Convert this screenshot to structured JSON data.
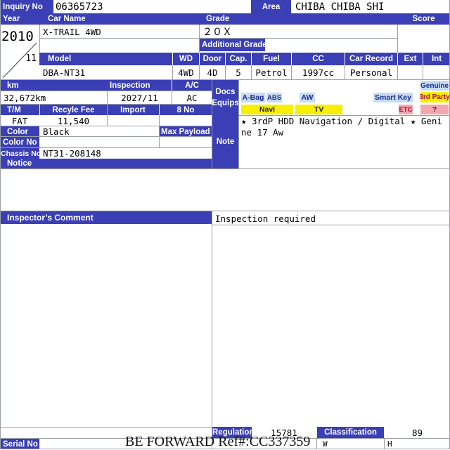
{
  "header": {
    "inquiry_label": "Inquiry No",
    "inquiry_value": "06365723",
    "area_label": "Area",
    "area_value": "CHIBA CHIBA SHI"
  },
  "vehicle": {
    "year_label": "Year",
    "year_value": "2010",
    "month_value": "11",
    "car_name_label": "Car Name",
    "car_name_value": "X-TRAIL 4WD",
    "grade_label": "Grade",
    "grade_value": "２０Ｘ",
    "additional_grade_label": "Additional Grade",
    "additional_grade_value": "",
    "score_label": "Score",
    "score_value": ""
  },
  "model_row": {
    "model_label": "Model",
    "model_value": "DBA-NT31",
    "wd_label": "WD",
    "wd_value": "4WD",
    "door_label": "Door",
    "door_value": "4D",
    "cap_label": "Cap.",
    "cap_value": "5",
    "fuel_label": "Fuel",
    "fuel_value": "Petrol",
    "cc_label": "CC",
    "cc_value": "1997cc",
    "car_record_label": "Car Record",
    "car_record_value": "Personal",
    "ext_label": "Ext",
    "ext_value": "",
    "int_label": "Int",
    "int_value": ""
  },
  "specs": {
    "km_label": "km",
    "km_value": "32,672km",
    "inspection_label": "Inspection",
    "inspection_value": "2027/11",
    "ac_label": "A/C",
    "ac_value": "AC",
    "tm_label": "T/M",
    "tm_value": "FAT",
    "recycle_label": "Recyle Fee",
    "recycle_value": "11,540",
    "import_label": "Import",
    "import_value": "",
    "eight_no_label": "8 No",
    "eight_no_value": "",
    "color_label": "Color",
    "color_value": "Black",
    "max_payload_label": "Max Payload",
    "max_payload_value": "",
    "color_no_label": "Color No",
    "color_no_value": "",
    "chassis_label": "Chassis No",
    "chassis_value": "NT31-208148",
    "notice_label": "Notice",
    "notice_value": ""
  },
  "equipment": {
    "docs_label": "Docs",
    "equips_label": "Equips",
    "abag": "A-Bag",
    "abs": "ABS",
    "aw": "AW",
    "smart_key": "Smart Key",
    "genuine": "Genuine",
    "third_party": "3rd Party",
    "navi": "Navi",
    "tv": "TV",
    "etc": "ETC",
    "question": "?",
    "note_label": "Note",
    "note_text": "★ 3rdP HDD Navigation / Digital ★ Genine 17 Aw"
  },
  "comments": {
    "inspector_label": "Inspector’s Comment",
    "inspector_value": "",
    "right_value": "Inspection required"
  },
  "footer": {
    "regulation_label": "Regulation",
    "regulation_value": "15781",
    "classification_label": "Classification",
    "classification_value": "89",
    "serial_label": "Serial No",
    "serial_value": "",
    "w_label": "W",
    "h_label": "H",
    "watermark": "BE FORWARD Ref#:CC337359"
  },
  "colors": {
    "label_bg": "#3a3fb5",
    "equip_tag_blue": "#c5dcf2",
    "equip_tag_yellow": "#f7ee00",
    "equip_tag_pink": "#f2a7b0"
  }
}
